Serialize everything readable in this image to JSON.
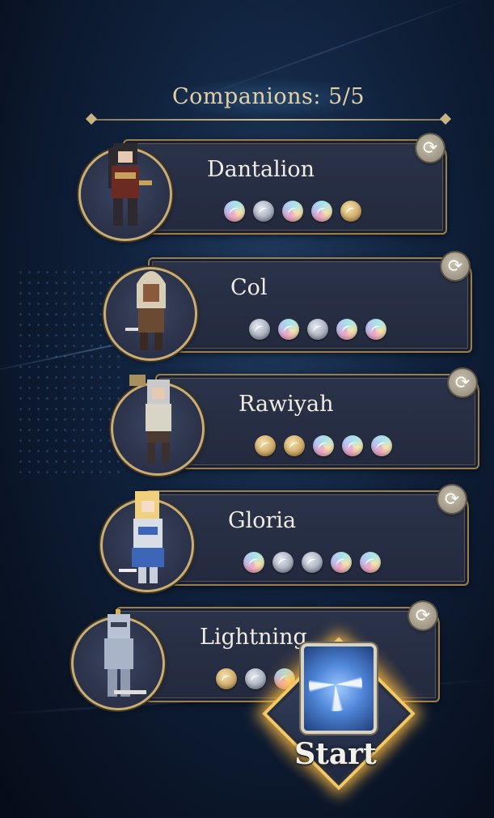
{
  "header": {
    "title": "Companions:  5/5"
  },
  "companions": [
    {
      "name": "Dantalion",
      "gems": [
        "rainbow",
        "silver",
        "rainbow",
        "rainbow",
        "gold"
      ],
      "sprite_color": "#2c2a2e"
    },
    {
      "name": "Col",
      "gems": [
        "silver",
        "rainbow",
        "silver",
        "rainbow",
        "rainbow"
      ],
      "sprite_color": "#d8cdb6"
    },
    {
      "name": "Rawiyah",
      "gems": [
        "gold",
        "gold",
        "rainbow",
        "rainbow",
        "rainbow"
      ],
      "sprite_color": "#c9c9c9"
    },
    {
      "name": "Gloria",
      "gems": [
        "rainbow",
        "silver",
        "silver",
        "rainbow",
        "rainbow"
      ],
      "sprite_color": "#f0d07a"
    },
    {
      "name": "Lightning",
      "gems": [
        "gold",
        "silver",
        "rainbow"
      ],
      "sprite_color": "#b8c2d4"
    }
  ],
  "start_button": {
    "label": "Start"
  },
  "icons": {
    "swap": "refresh-icon",
    "gem": "orb-icon"
  }
}
